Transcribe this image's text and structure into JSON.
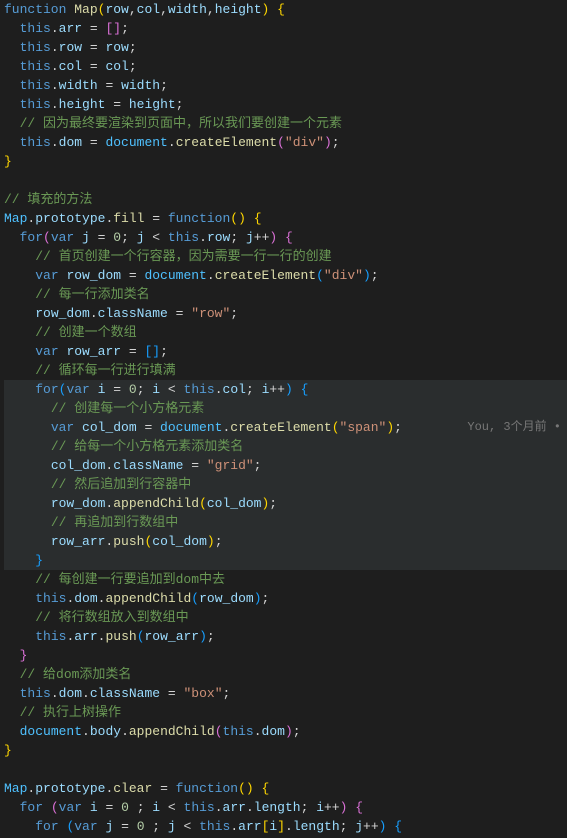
{
  "annotation": "You, 3个月前 •",
  "lines": [
    {
      "t": [
        [
          "kw",
          "function"
        ],
        [
          "punc",
          " "
        ],
        [
          "fn",
          "Map"
        ],
        [
          "brace-main",
          "("
        ],
        [
          "param",
          "row"
        ],
        [
          "punc",
          ","
        ],
        [
          "param",
          "col"
        ],
        [
          "punc",
          ","
        ],
        [
          "param",
          "width"
        ],
        [
          "punc",
          ","
        ],
        [
          "param",
          "height"
        ],
        [
          "brace-main",
          ") "
        ],
        [
          "brace-main",
          "{"
        ]
      ]
    },
    {
      "t": [
        [
          "punc",
          "  "
        ],
        [
          "kw",
          "this"
        ],
        [
          "punc",
          "."
        ],
        [
          "prop",
          "arr"
        ],
        [
          "punc",
          " = "
        ],
        [
          "brace1",
          "[]"
        ],
        [
          "punc",
          ";"
        ]
      ]
    },
    {
      "t": [
        [
          "punc",
          "  "
        ],
        [
          "kw",
          "this"
        ],
        [
          "punc",
          "."
        ],
        [
          "prop",
          "row"
        ],
        [
          "punc",
          " = "
        ],
        [
          "prop",
          "row"
        ],
        [
          "punc",
          ";"
        ]
      ]
    },
    {
      "t": [
        [
          "punc",
          "  "
        ],
        [
          "kw",
          "this"
        ],
        [
          "punc",
          "."
        ],
        [
          "prop",
          "col"
        ],
        [
          "punc",
          " = "
        ],
        [
          "prop",
          "col"
        ],
        [
          "punc",
          ";"
        ]
      ]
    },
    {
      "t": [
        [
          "punc",
          "  "
        ],
        [
          "kw",
          "this"
        ],
        [
          "punc",
          "."
        ],
        [
          "prop",
          "width"
        ],
        [
          "punc",
          " = "
        ],
        [
          "prop",
          "width"
        ],
        [
          "punc",
          ";"
        ]
      ]
    },
    {
      "t": [
        [
          "punc",
          "  "
        ],
        [
          "kw",
          "this"
        ],
        [
          "punc",
          "."
        ],
        [
          "prop",
          "height"
        ],
        [
          "punc",
          " = "
        ],
        [
          "prop",
          "height"
        ],
        [
          "punc",
          ";"
        ]
      ]
    },
    {
      "t": [
        [
          "punc",
          "  "
        ],
        [
          "cmt",
          "// 因为最终要渲染到页面中，所以我们要创建一个元素"
        ]
      ]
    },
    {
      "t": [
        [
          "punc",
          "  "
        ],
        [
          "kw",
          "this"
        ],
        [
          "punc",
          "."
        ],
        [
          "prop",
          "dom"
        ],
        [
          "punc",
          " = "
        ],
        [
          "var",
          "document"
        ],
        [
          "punc",
          "."
        ],
        [
          "fn",
          "createElement"
        ],
        [
          "brace1",
          "("
        ],
        [
          "str",
          "\"div\""
        ],
        [
          "brace1",
          ")"
        ],
        [
          "punc",
          ";"
        ]
      ]
    },
    {
      "t": [
        [
          "brace-main",
          "}"
        ]
      ]
    },
    {
      "t": [
        [
          "punc",
          " "
        ]
      ]
    },
    {
      "t": [
        [
          "cmt",
          "// 填充的方法"
        ]
      ]
    },
    {
      "t": [
        [
          "var",
          "Map"
        ],
        [
          "punc",
          "."
        ],
        [
          "prop",
          "prototype"
        ],
        [
          "punc",
          "."
        ],
        [
          "fn",
          "fill"
        ],
        [
          "punc",
          " = "
        ],
        [
          "kw",
          "function"
        ],
        [
          "brace-main",
          "()"
        ],
        [
          "punc",
          " "
        ],
        [
          "brace-main",
          "{"
        ]
      ]
    },
    {
      "t": [
        [
          "punc",
          "  "
        ],
        [
          "kw",
          "for"
        ],
        [
          "brace1",
          "("
        ],
        [
          "kw",
          "var"
        ],
        [
          "punc",
          " "
        ],
        [
          "prop",
          "j"
        ],
        [
          "punc",
          " = "
        ],
        [
          "num",
          "0"
        ],
        [
          "punc",
          "; "
        ],
        [
          "prop",
          "j"
        ],
        [
          "punc",
          " < "
        ],
        [
          "kw",
          "this"
        ],
        [
          "punc",
          "."
        ],
        [
          "prop",
          "row"
        ],
        [
          "punc",
          "; "
        ],
        [
          "prop",
          "j"
        ],
        [
          "punc",
          "++"
        ],
        [
          "brace1",
          ")"
        ],
        [
          "punc",
          " "
        ],
        [
          "brace1",
          "{"
        ]
      ]
    },
    {
      "t": [
        [
          "punc",
          "    "
        ],
        [
          "cmt",
          "// 首页创建一个行容器，因为需要一行一行的创建"
        ]
      ]
    },
    {
      "t": [
        [
          "punc",
          "    "
        ],
        [
          "kw",
          "var"
        ],
        [
          "punc",
          " "
        ],
        [
          "prop",
          "row_dom"
        ],
        [
          "punc",
          " = "
        ],
        [
          "var",
          "document"
        ],
        [
          "punc",
          "."
        ],
        [
          "fn",
          "createElement"
        ],
        [
          "brace2",
          "("
        ],
        [
          "str",
          "\"div\""
        ],
        [
          "brace2",
          ")"
        ],
        [
          "punc",
          ";"
        ]
      ]
    },
    {
      "t": [
        [
          "punc",
          "    "
        ],
        [
          "cmt",
          "// 每一行添加类名"
        ]
      ]
    },
    {
      "t": [
        [
          "punc",
          "    "
        ],
        [
          "prop",
          "row_dom"
        ],
        [
          "punc",
          "."
        ],
        [
          "prop",
          "className"
        ],
        [
          "punc",
          " = "
        ],
        [
          "str",
          "\"row\""
        ],
        [
          "punc",
          ";"
        ]
      ]
    },
    {
      "t": [
        [
          "punc",
          "    "
        ],
        [
          "cmt",
          "// 创建一个数组"
        ]
      ]
    },
    {
      "t": [
        [
          "punc",
          "    "
        ],
        [
          "kw",
          "var"
        ],
        [
          "punc",
          " "
        ],
        [
          "prop",
          "row_arr"
        ],
        [
          "punc",
          " = "
        ],
        [
          "brace2",
          "[]"
        ],
        [
          "punc",
          ";"
        ]
      ]
    },
    {
      "t": [
        [
          "punc",
          "    "
        ],
        [
          "cmt",
          "// 循环每一行进行填满"
        ]
      ]
    },
    {
      "t": [
        [
          "punc",
          "    "
        ],
        [
          "kw",
          "for"
        ],
        [
          "brace2",
          "("
        ],
        [
          "kw",
          "var"
        ],
        [
          "punc",
          " "
        ],
        [
          "prop",
          "i"
        ],
        [
          "punc",
          " = "
        ],
        [
          "num",
          "0"
        ],
        [
          "punc",
          "; "
        ],
        [
          "prop",
          "i"
        ],
        [
          "punc",
          " < "
        ],
        [
          "kw",
          "this"
        ],
        [
          "punc",
          "."
        ],
        [
          "prop",
          "col"
        ],
        [
          "punc",
          "; "
        ],
        [
          "prop",
          "i"
        ],
        [
          "punc",
          "++"
        ],
        [
          "brace2",
          ")"
        ],
        [
          "punc",
          " "
        ],
        [
          "brace2",
          "{"
        ]
      ],
      "hl": true
    },
    {
      "t": [
        [
          "punc",
          "      "
        ],
        [
          "cmt",
          "// 创建每一个小方格元素"
        ]
      ],
      "hl": true
    },
    {
      "t": [
        [
          "punc",
          "      "
        ],
        [
          "kw",
          "var"
        ],
        [
          "punc",
          " "
        ],
        [
          "prop",
          "col_dom"
        ],
        [
          "punc",
          " = "
        ],
        [
          "var",
          "document"
        ],
        [
          "punc",
          "."
        ],
        [
          "fn",
          "createElement"
        ],
        [
          "brace-main",
          "("
        ],
        [
          "str",
          "\"span\""
        ],
        [
          "brace-main",
          ")"
        ],
        [
          "punc",
          ";"
        ]
      ],
      "hl": true,
      "ann": true
    },
    {
      "t": [
        [
          "punc",
          "      "
        ],
        [
          "cmt",
          "// 给每一个小方格元素添加类名"
        ]
      ],
      "hl": true
    },
    {
      "t": [
        [
          "punc",
          "      "
        ],
        [
          "prop",
          "col_dom"
        ],
        [
          "punc",
          "."
        ],
        [
          "prop",
          "className"
        ],
        [
          "punc",
          " = "
        ],
        [
          "str",
          "\"grid\""
        ],
        [
          "punc",
          ";"
        ]
      ],
      "hl": true
    },
    {
      "t": [
        [
          "punc",
          "      "
        ],
        [
          "cmt",
          "// 然后追加到行容器中"
        ]
      ],
      "hl": true
    },
    {
      "t": [
        [
          "punc",
          "      "
        ],
        [
          "prop",
          "row_dom"
        ],
        [
          "punc",
          "."
        ],
        [
          "fn",
          "appendChild"
        ],
        [
          "brace-main",
          "("
        ],
        [
          "prop",
          "col_dom"
        ],
        [
          "brace-main",
          ")"
        ],
        [
          "punc",
          ";"
        ]
      ],
      "hl": true
    },
    {
      "t": [
        [
          "punc",
          "      "
        ],
        [
          "cmt",
          "// 再追加到行数组中"
        ]
      ],
      "hl": true
    },
    {
      "t": [
        [
          "punc",
          "      "
        ],
        [
          "prop",
          "row_arr"
        ],
        [
          "punc",
          "."
        ],
        [
          "fn",
          "push"
        ],
        [
          "brace-main",
          "("
        ],
        [
          "prop",
          "col_dom"
        ],
        [
          "brace-main",
          ")"
        ],
        [
          "punc",
          ";"
        ]
      ],
      "hl": true
    },
    {
      "t": [
        [
          "punc",
          "    "
        ],
        [
          "brace2",
          "}"
        ]
      ],
      "hl": true
    },
    {
      "t": [
        [
          "punc",
          "    "
        ],
        [
          "cmt",
          "// 每创建一行要追加到dom中去"
        ]
      ]
    },
    {
      "t": [
        [
          "punc",
          "    "
        ],
        [
          "kw",
          "this"
        ],
        [
          "punc",
          "."
        ],
        [
          "prop",
          "dom"
        ],
        [
          "punc",
          "."
        ],
        [
          "fn",
          "appendChild"
        ],
        [
          "brace2",
          "("
        ],
        [
          "prop",
          "row_dom"
        ],
        [
          "brace2",
          ")"
        ],
        [
          "punc",
          ";"
        ]
      ]
    },
    {
      "t": [
        [
          "punc",
          "    "
        ],
        [
          "cmt",
          "// 将行数组放入到数组中"
        ]
      ]
    },
    {
      "t": [
        [
          "punc",
          "    "
        ],
        [
          "kw",
          "this"
        ],
        [
          "punc",
          "."
        ],
        [
          "prop",
          "arr"
        ],
        [
          "punc",
          "."
        ],
        [
          "fn",
          "push"
        ],
        [
          "brace2",
          "("
        ],
        [
          "prop",
          "row_arr"
        ],
        [
          "brace2",
          ")"
        ],
        [
          "punc",
          ";"
        ]
      ]
    },
    {
      "t": [
        [
          "punc",
          "  "
        ],
        [
          "brace1",
          "}"
        ]
      ]
    },
    {
      "t": [
        [
          "punc",
          "  "
        ],
        [
          "cmt",
          "// 给dom添加类名"
        ]
      ]
    },
    {
      "t": [
        [
          "punc",
          "  "
        ],
        [
          "kw",
          "this"
        ],
        [
          "punc",
          "."
        ],
        [
          "prop",
          "dom"
        ],
        [
          "punc",
          "."
        ],
        [
          "prop",
          "className"
        ],
        [
          "punc",
          " = "
        ],
        [
          "str",
          "\"box\""
        ],
        [
          "punc",
          ";"
        ]
      ]
    },
    {
      "t": [
        [
          "punc",
          "  "
        ],
        [
          "cmt",
          "// 执行上树操作"
        ]
      ]
    },
    {
      "t": [
        [
          "punc",
          "  "
        ],
        [
          "var",
          "document"
        ],
        [
          "punc",
          "."
        ],
        [
          "prop",
          "body"
        ],
        [
          "punc",
          "."
        ],
        [
          "fn",
          "appendChild"
        ],
        [
          "brace1",
          "("
        ],
        [
          "kw",
          "this"
        ],
        [
          "punc",
          "."
        ],
        [
          "prop",
          "dom"
        ],
        [
          "brace1",
          ")"
        ],
        [
          "punc",
          ";"
        ]
      ]
    },
    {
      "t": [
        [
          "brace-main",
          "}"
        ]
      ]
    },
    {
      "t": [
        [
          "punc",
          " "
        ]
      ]
    },
    {
      "t": [
        [
          "var",
          "Map"
        ],
        [
          "punc",
          "."
        ],
        [
          "prop",
          "prototype"
        ],
        [
          "punc",
          "."
        ],
        [
          "fn",
          "clear"
        ],
        [
          "punc",
          " = "
        ],
        [
          "kw",
          "function"
        ],
        [
          "brace-main",
          "()"
        ],
        [
          "punc",
          " "
        ],
        [
          "brace-main",
          "{"
        ]
      ]
    },
    {
      "t": [
        [
          "punc",
          "  "
        ],
        [
          "kw",
          "for"
        ],
        [
          "punc",
          " "
        ],
        [
          "brace1",
          "("
        ],
        [
          "kw",
          "var"
        ],
        [
          "punc",
          " "
        ],
        [
          "prop",
          "i"
        ],
        [
          "punc",
          " = "
        ],
        [
          "num",
          "0"
        ],
        [
          "punc",
          " ; "
        ],
        [
          "prop",
          "i"
        ],
        [
          "punc",
          " < "
        ],
        [
          "kw",
          "this"
        ],
        [
          "punc",
          "."
        ],
        [
          "prop",
          "arr"
        ],
        [
          "punc",
          "."
        ],
        [
          "prop",
          "length"
        ],
        [
          "punc",
          "; "
        ],
        [
          "prop",
          "i"
        ],
        [
          "punc",
          "++"
        ],
        [
          "brace1",
          ")"
        ],
        [
          "punc",
          " "
        ],
        [
          "brace1",
          "{"
        ]
      ]
    },
    {
      "t": [
        [
          "punc",
          "    "
        ],
        [
          "kw",
          "for"
        ],
        [
          "punc",
          " "
        ],
        [
          "brace2",
          "("
        ],
        [
          "kw",
          "var"
        ],
        [
          "punc",
          " "
        ],
        [
          "prop",
          "j"
        ],
        [
          "punc",
          " = "
        ],
        [
          "num",
          "0"
        ],
        [
          "punc",
          " ; "
        ],
        [
          "prop",
          "j"
        ],
        [
          "punc",
          " < "
        ],
        [
          "kw",
          "this"
        ],
        [
          "punc",
          "."
        ],
        [
          "prop",
          "arr"
        ],
        [
          "brace-main",
          "["
        ],
        [
          "prop",
          "i"
        ],
        [
          "brace-main",
          "]"
        ],
        [
          "punc",
          "."
        ],
        [
          "prop",
          "length"
        ],
        [
          "punc",
          "; "
        ],
        [
          "prop",
          "j"
        ],
        [
          "punc",
          "++"
        ],
        [
          "brace2",
          ")"
        ],
        [
          "punc",
          " "
        ],
        [
          "brace2",
          "{"
        ]
      ]
    }
  ]
}
